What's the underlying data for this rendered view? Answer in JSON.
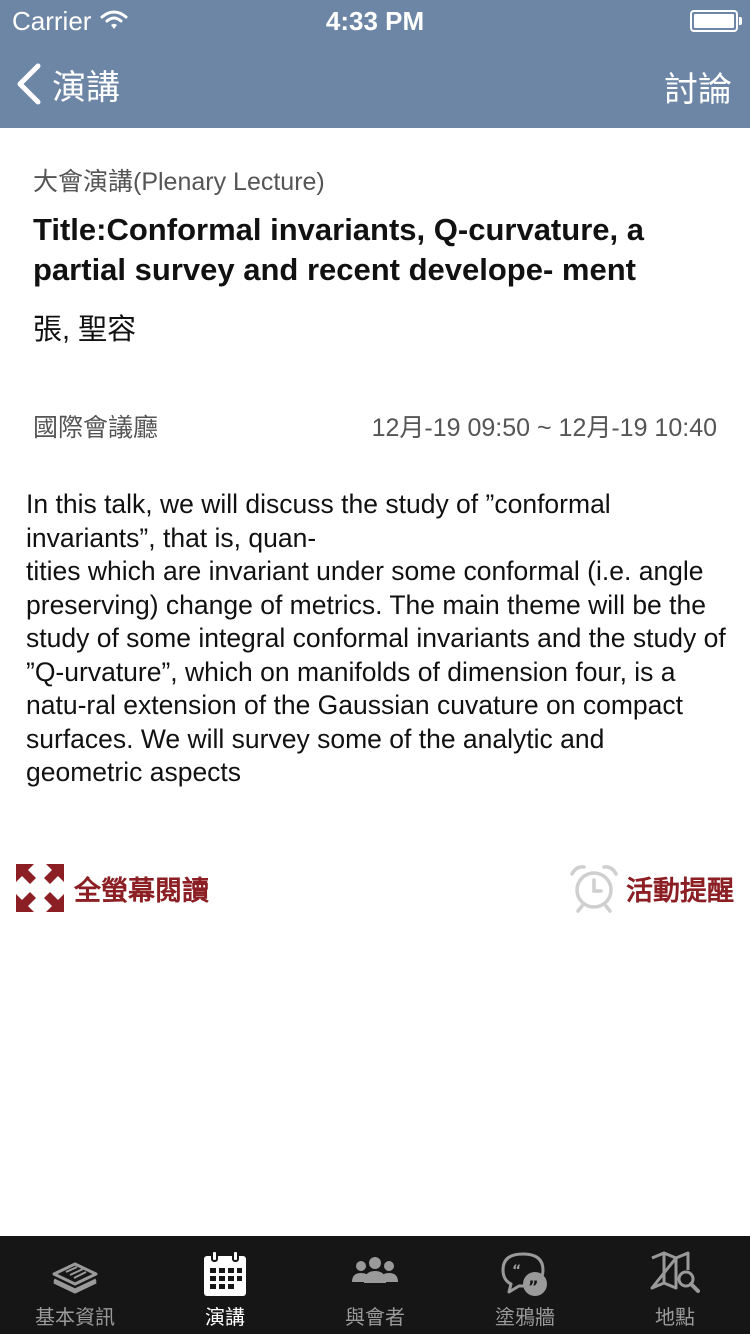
{
  "status_bar": {
    "carrier": "Carrier",
    "time": "4:33 PM"
  },
  "nav": {
    "back_label": "演講",
    "right_label": "討論"
  },
  "talk": {
    "session_type": "大會演講(Plenary Lecture)",
    "title": "Title:Conformal invariants, Q-curvature, a partial survey and recent develope- ment",
    "speaker": "張, 聖容",
    "venue": "國際會議廳",
    "time_range": "12月-19 09:50 ~ 12月-19 10:40",
    "abstract": "In this talk, we will discuss the study of ”conformal invariants”, that is, quan-\ntities which are invariant under some conformal (i.e. angle preserving) change of metrics. The main theme will be the study of some integral conformal invariants and the study of ”Q-urvature”, which on manifolds of dimension four, is a natu-ral extension of the Gaussian cuvature on compact surfaces. We will survey some of the analytic and  geometric aspects"
  },
  "actions": {
    "fullscreen_label": "全螢幕閱讀",
    "reminder_label": "活動提醒"
  },
  "tabs": [
    {
      "label": "基本資訊",
      "icon": "newspaper-icon",
      "active": false
    },
    {
      "label": "演講",
      "icon": "calendar-icon",
      "active": true
    },
    {
      "label": "與會者",
      "icon": "people-icon",
      "active": false
    },
    {
      "label": "塗鴉牆",
      "icon": "chat-bubble-icon",
      "active": false
    },
    {
      "label": "地點",
      "icon": "map-search-icon",
      "active": false
    }
  ],
  "colors": {
    "nav_bar": "#6d86a6",
    "accent_red": "#8b1f24",
    "tab_bar": "#161616"
  }
}
